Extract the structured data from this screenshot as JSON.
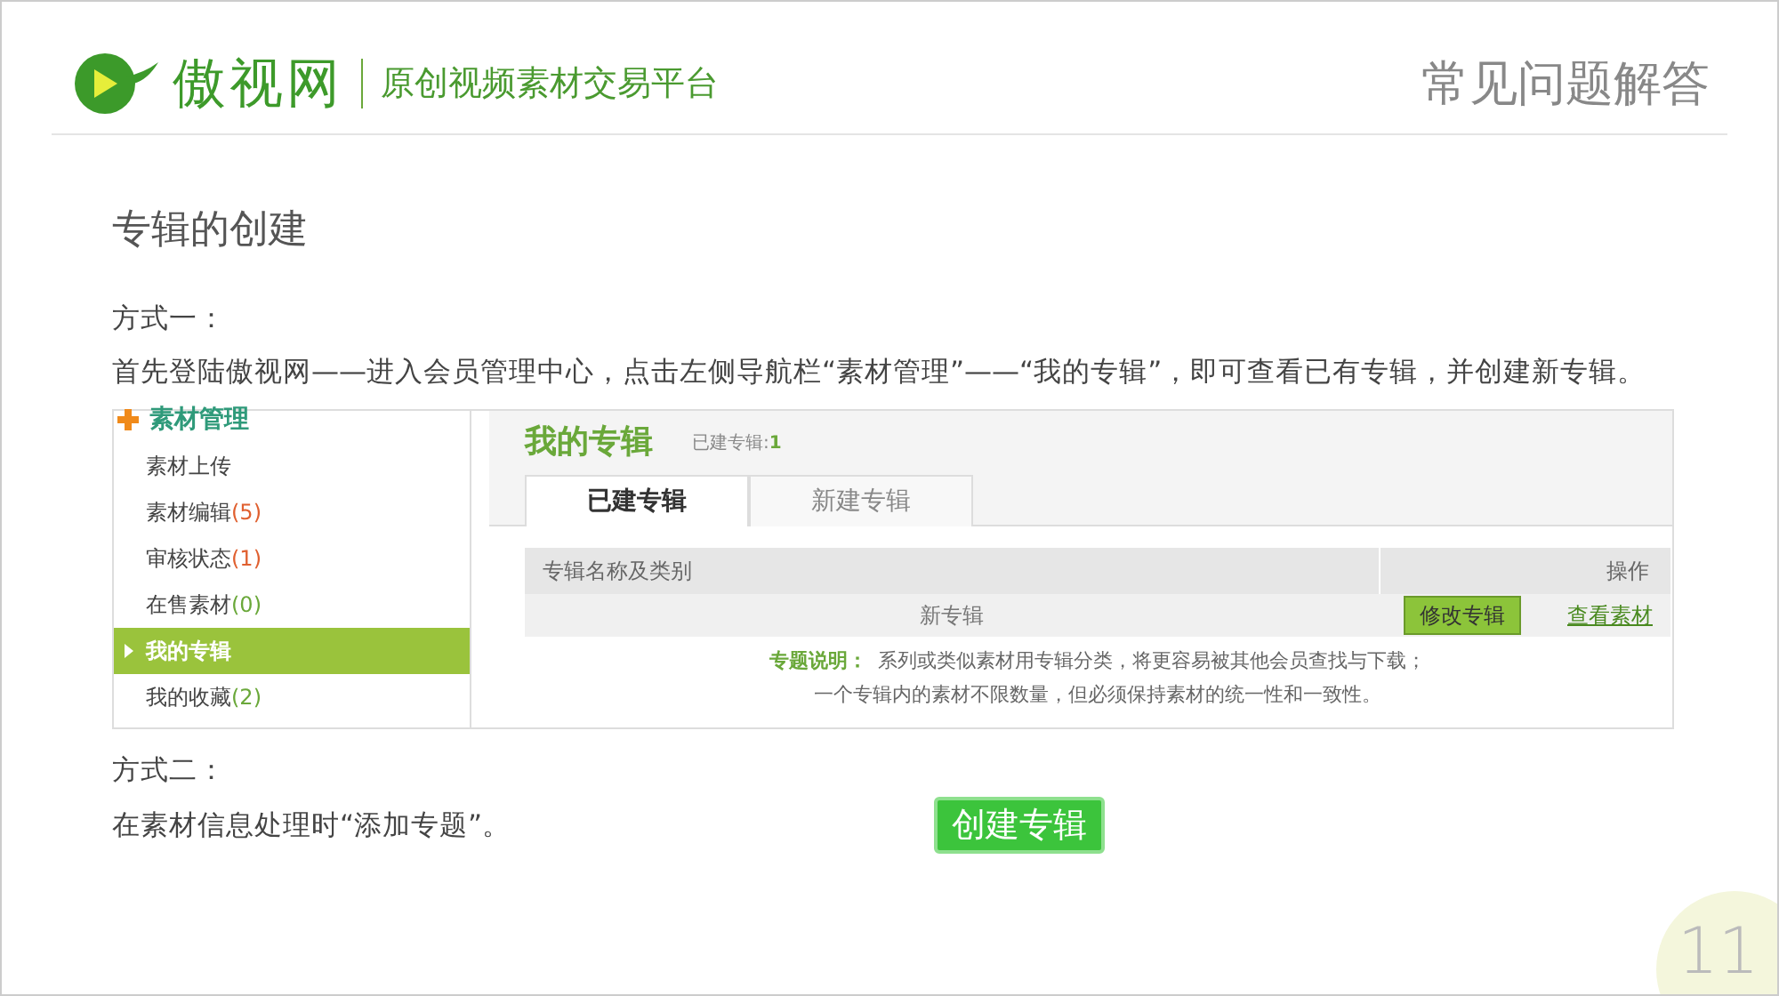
{
  "header": {
    "logo_name": "傲视网",
    "logo_tagline": "原创视频素材交易平台",
    "title": "常见问题解答"
  },
  "heading": "专辑的创建",
  "method_one": {
    "label": "方式一：",
    "text": "首先登陆傲视网——进入会员管理中心，点击左侧导航栏“素材管理”——“我的专辑”，即可查看已有专辑，并创建新专辑。"
  },
  "screenshot": {
    "sidebar": {
      "title": "素材管理",
      "items": [
        {
          "label": "素材上传",
          "selected": false
        },
        {
          "label": "素材编辑",
          "count": "(5)",
          "color": "#e06030",
          "selected": false
        },
        {
          "label": "审核状态",
          "count": "(1)",
          "color": "#e06030",
          "selected": false
        },
        {
          "label": "在售素材",
          "count": "(0)",
          "color": "#6aa83a",
          "selected": false
        },
        {
          "label": "我的专辑",
          "selected": true
        },
        {
          "label": "我的收藏 ",
          "count": "(2)",
          "color": "#6aa83a",
          "selected": false
        }
      ]
    },
    "title": "我的专辑",
    "created_label": "已建专辑:",
    "created_count": "1",
    "tabs": [
      {
        "label": "已建专辑",
        "selected": true
      },
      {
        "label": "新建专辑",
        "selected": false
      }
    ],
    "table": {
      "columns": [
        "专辑名称及类别",
        "操作"
      ],
      "rows": [
        {
          "name": "新专辑",
          "edit_button": "修改专辑",
          "view_link": "查看素材"
        }
      ]
    },
    "note_label": "专题说明：",
    "note_lines": [
      "系列或类似素材用专辑分类，将更容易被其他会员查找与下载；",
      "一个专辑内的素材不限数量，但必须保持素材的统一性和一致性。"
    ]
  },
  "method_two": {
    "label": "方式二：",
    "text": "在素材信息处理时“添加专题”。",
    "button": "创建专辑"
  },
  "page_number": "11"
}
